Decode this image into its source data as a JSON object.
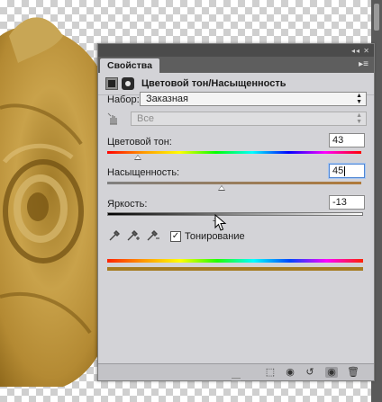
{
  "panel": {
    "tab_label": "Свойства",
    "title": "Цветовой тон/Насыщенность",
    "preset_label": "Набор:",
    "preset_value": "Заказная",
    "channel_value": "Все",
    "hue": {
      "label": "Цветовой тон:",
      "value": "43",
      "level_fraction": 0.12
    },
    "saturation": {
      "label": "Насыщенность:",
      "value": "45",
      "level_fraction": 0.45
    },
    "lightness": {
      "label": "Яркость:",
      "value": "-13",
      "level_fraction": 0.43
    },
    "colorize": {
      "label": "Тонирование",
      "checked": true,
      "check_glyph": "✓"
    }
  },
  "icons": {
    "adjustment": "hue-saturation-icon",
    "mask": "mask-icon",
    "hand": "targeted-adjustment-hand-icon",
    "eyedroppers": [
      "eyedropper-icon",
      "eyedropper-plus-icon",
      "eyedropper-minus-icon"
    ],
    "bottom": [
      "clip-to-layer-icon",
      "view-previous-icon",
      "reset-icon",
      "visibility-eye-icon",
      "trash-icon"
    ]
  },
  "colors": {
    "result_bar": "#a67d22",
    "panel_bg": "#d3d3d7"
  }
}
